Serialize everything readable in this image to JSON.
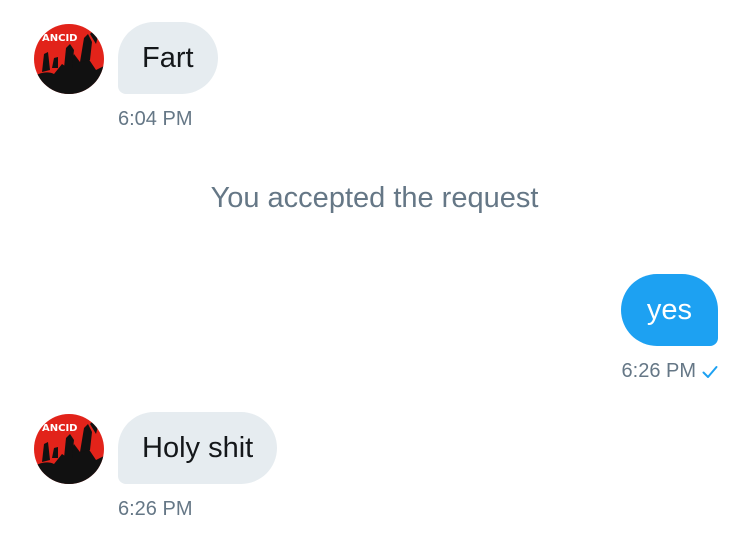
{
  "conversation": {
    "messages": [
      {
        "direction": "incoming",
        "text": "Fart",
        "time": "6:04 PM"
      },
      {
        "direction": "outgoing",
        "text": "yes",
        "time": "6:26 PM",
        "status": "sent"
      },
      {
        "direction": "incoming",
        "text": "Holy shit",
        "time": "6:26 PM"
      }
    ],
    "system_message": "You accepted the request",
    "avatar_logo_text": "ANCID",
    "colors": {
      "incoming_bubble": "#e6ecf0",
      "outgoing_bubble": "#1da1f2",
      "timestamp": "#657786",
      "check": "#1da1f2",
      "avatar_red": "#e2231a",
      "avatar_black": "#111111"
    },
    "icons": {
      "sent_status": "checkmark-icon",
      "avatar": "band-logo-avatar"
    }
  }
}
